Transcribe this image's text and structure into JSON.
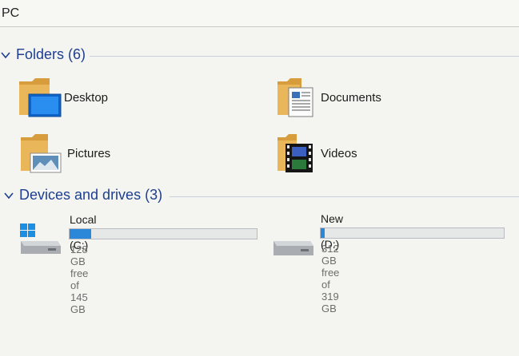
{
  "address": {
    "text": "PC"
  },
  "sections": {
    "folders": {
      "title": "Folders (6)"
    },
    "devices": {
      "title": "Devices and drives (3)"
    }
  },
  "folders": [
    {
      "label": "Desktop",
      "icon": "desktop-folder-icon"
    },
    {
      "label": "Documents",
      "icon": "documents-folder-icon"
    },
    {
      "label": "Pictures",
      "icon": "pictures-folder-icon"
    },
    {
      "label": "Videos",
      "icon": "videos-folder-icon"
    }
  ],
  "drives": [
    {
      "name": "Local Disk (C:)",
      "free_text": "128 GB free of 145 GB",
      "used_fraction": 0.117,
      "icon": "windows-drive-icon"
    },
    {
      "name": "New Volume (D:)",
      "free_text": "312 GB free of 319 GB",
      "used_fraction": 0.022,
      "icon": "drive-icon"
    }
  ],
  "colors": {
    "section_title": "#1e3f8f",
    "usage_bar": "#2b88d8",
    "folder": "#e7b45a"
  }
}
